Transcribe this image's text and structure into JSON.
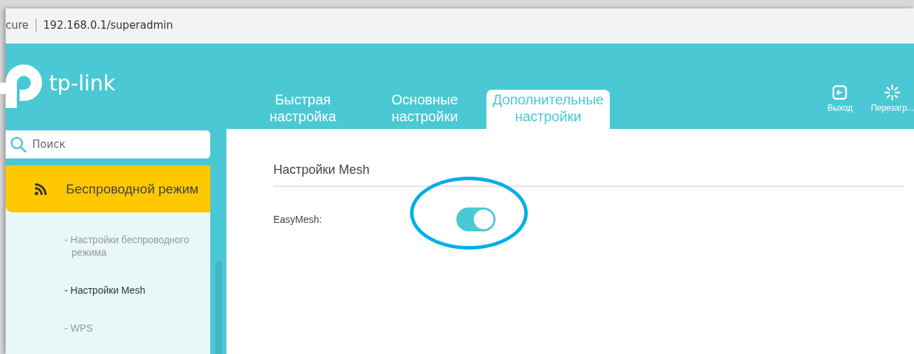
{
  "address_bar": {
    "scheme_fragment": "cure",
    "url": "192.168.0.1/superadmin"
  },
  "header": {
    "logo": "tp-link",
    "tabs": [
      {
        "label": "Быстрая настройка",
        "selected": false
      },
      {
        "label": "Основные настройки",
        "selected": false
      },
      {
        "label": "Дополнительные настройки",
        "selected": true
      }
    ],
    "actions": [
      {
        "kind": "logout",
        "label": "Выход"
      },
      {
        "kind": "reboot",
        "label": "Перезагр..."
      }
    ]
  },
  "sidebar": {
    "search": {
      "placeholder": "Поиск"
    },
    "section": {
      "label": "Беспроводной режим",
      "selected": true
    },
    "items": [
      {
        "label": "- Настройки беспроводного режима",
        "selected": false
      },
      {
        "label": "- Настройки Mesh",
        "selected": true
      },
      {
        "label": "- WPS",
        "selected": false
      }
    ]
  },
  "content": {
    "title": "Настройки Mesh",
    "fields": [
      {
        "label": "EasyMesh:",
        "on": true
      }
    ]
  }
}
